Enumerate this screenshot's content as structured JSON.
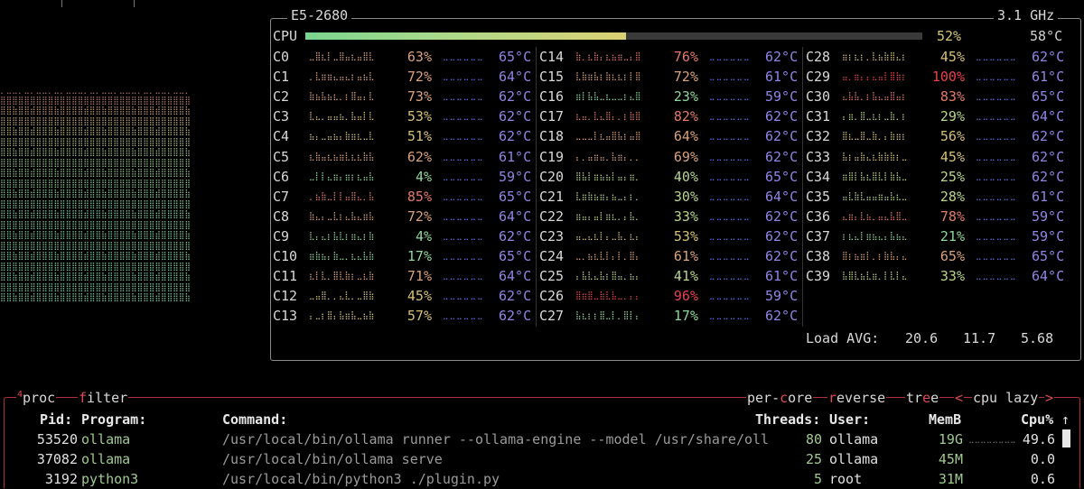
{
  "top_left": {
    "text": ""
  },
  "cpu_box": {
    "title": "E5-2680",
    "freq": "3.1 GHz",
    "total_label": "CPU",
    "total_pct": "52%",
    "total_pct_value": 52,
    "total_temp": "58°C",
    "cores": [
      {
        "name": "C0",
        "pct": "63%",
        "temp": "65°C"
      },
      {
        "name": "C1",
        "pct": "72%",
        "temp": "64°C"
      },
      {
        "name": "C2",
        "pct": "73%",
        "temp": "62°C"
      },
      {
        "name": "C3",
        "pct": "53%",
        "temp": "62°C"
      },
      {
        "name": "C4",
        "pct": "51%",
        "temp": "62°C"
      },
      {
        "name": "C5",
        "pct": "62%",
        "temp": "61°C"
      },
      {
        "name": "C6",
        "pct": "4%",
        "temp": "59°C"
      },
      {
        "name": "C7",
        "pct": "85%",
        "temp": "65°C"
      },
      {
        "name": "C8",
        "pct": "72%",
        "temp": "64°C"
      },
      {
        "name": "C9",
        "pct": "4%",
        "temp": "62°C"
      },
      {
        "name": "C10",
        "pct": "17%",
        "temp": "65°C"
      },
      {
        "name": "C11",
        "pct": "71%",
        "temp": "64°C"
      },
      {
        "name": "C12",
        "pct": "45%",
        "temp": "62°C"
      },
      {
        "name": "C13",
        "pct": "57%",
        "temp": "62°C"
      },
      {
        "name": "C14",
        "pct": "76%",
        "temp": "62°C"
      },
      {
        "name": "C15",
        "pct": "72%",
        "temp": "61°C"
      },
      {
        "name": "C16",
        "pct": "23%",
        "temp": "59°C"
      },
      {
        "name": "C17",
        "pct": "82%",
        "temp": "62°C"
      },
      {
        "name": "C18",
        "pct": "64%",
        "temp": "62°C"
      },
      {
        "name": "C19",
        "pct": "69%",
        "temp": "62°C"
      },
      {
        "name": "C20",
        "pct": "40%",
        "temp": "65°C"
      },
      {
        "name": "C21",
        "pct": "30%",
        "temp": "64°C"
      },
      {
        "name": "C22",
        "pct": "33%",
        "temp": "62°C"
      },
      {
        "name": "C23",
        "pct": "53%",
        "temp": "62°C"
      },
      {
        "name": "C24",
        "pct": "61%",
        "temp": "62°C"
      },
      {
        "name": "C25",
        "pct": "41%",
        "temp": "61°C"
      },
      {
        "name": "C26",
        "pct": "96%",
        "temp": "59°C"
      },
      {
        "name": "C27",
        "pct": "17%",
        "temp": "62°C"
      },
      {
        "name": "C28",
        "pct": "45%",
        "temp": "62°C"
      },
      {
        "name": "C29",
        "pct": "100%",
        "temp": "61°C"
      },
      {
        "name": "C30",
        "pct": "83%",
        "temp": "65°C"
      },
      {
        "name": "C31",
        "pct": "29%",
        "temp": "64°C"
      },
      {
        "name": "C32",
        "pct": "56%",
        "temp": "62°C"
      },
      {
        "name": "C33",
        "pct": "45%",
        "temp": "62°C"
      },
      {
        "name": "C34",
        "pct": "25%",
        "temp": "62°C"
      },
      {
        "name": "C35",
        "pct": "28%",
        "temp": "61°C"
      },
      {
        "name": "C36",
        "pct": "78%",
        "temp": "59°C"
      },
      {
        "name": "C37",
        "pct": "21%",
        "temp": "59°C"
      },
      {
        "name": "C38",
        "pct": "65%",
        "temp": "65°C"
      },
      {
        "name": "C39",
        "pct": "33%",
        "temp": "64°C"
      }
    ],
    "load_label": "Load AVG:",
    "load": [
      "20.6",
      "11.7",
      "5.68"
    ]
  },
  "proc_box": {
    "num": "4",
    "title": "proc",
    "filter": "filter",
    "options": {
      "per_core": "per-core",
      "reverse": "reverse",
      "tree": "tree",
      "sort_left": "<",
      "sort_name": "cpu lazy",
      "sort_right": ">"
    },
    "columns": {
      "pid": "Pid:",
      "program": "Program:",
      "command": "Command:",
      "threads": "Threads:",
      "user": "User:",
      "mem": "MemB",
      "cpu": "Cpu%"
    },
    "scroll_arrow": "↑",
    "rows": [
      {
        "pid": "53520",
        "program": "ollama",
        "command": "/usr/local/bin/ollama runner --ollama-engine --model /usr/share/oll",
        "threads": "80",
        "user": "ollama",
        "mem": "19G",
        "cpu": "49.6"
      },
      {
        "pid": "37082",
        "program": "ollama",
        "command": "/usr/local/bin/ollama serve",
        "threads": "25",
        "user": "ollama",
        "mem": "45M",
        "cpu": "0.0"
      },
      {
        "pid": "3192",
        "program": "python3",
        "command": "/usr/local/bin/python3 ./plugin.py",
        "threads": "5",
        "user": "root",
        "mem": "31M",
        "cpu": "0.6"
      }
    ]
  },
  "colors": {
    "box_border": "#8a8a8a",
    "proc_border": "#b0303c",
    "temp": "#8f85e6",
    "program": "#9fc98f"
  }
}
